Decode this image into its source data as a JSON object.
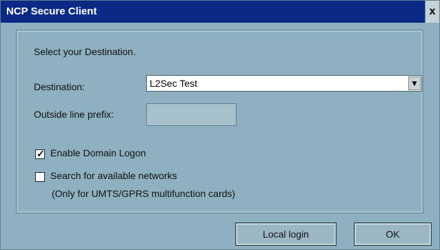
{
  "title": "NCP Secure Client",
  "close_label": "x",
  "instruction": "Select your Destination.",
  "destination": {
    "label": "Destination:",
    "value": "L2Sec Test"
  },
  "outside_line_prefix": {
    "label": "Outside line prefix:",
    "value": ""
  },
  "enable_domain_logon": {
    "label": "Enable Domain Logon",
    "checked": true
  },
  "search_networks": {
    "label": "Search for available networks",
    "checked": false,
    "note": "(Only for UMTS/GPRS multifunction cards)"
  },
  "buttons": {
    "local_login": "Local login",
    "ok": "OK"
  }
}
